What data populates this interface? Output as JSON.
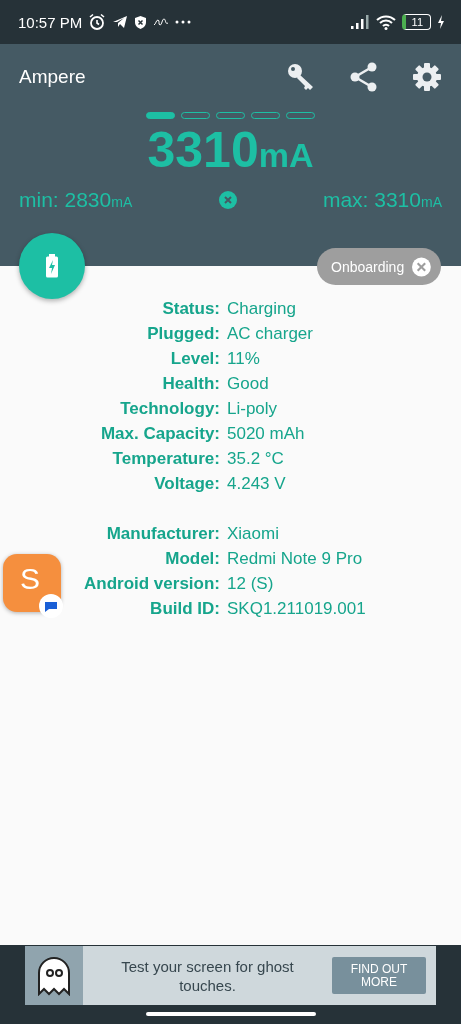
{
  "status_bar": {
    "time": "10:57 PM",
    "battery": "11"
  },
  "app_bar": {
    "title": "Ampere"
  },
  "pager": [
    {
      "selected": true
    },
    {
      "selected": false
    },
    {
      "selected": false
    },
    {
      "selected": false
    },
    {
      "selected": false
    }
  ],
  "current": {
    "value": "3310",
    "unit": "mA"
  },
  "min": {
    "label": "min: 2830",
    "unit": "mA"
  },
  "max": {
    "label": "max: 3310",
    "unit": "mA"
  },
  "onboarding": {
    "label": "Onboarding"
  },
  "info_groups": [
    [
      {
        "label": "Status:",
        "value": "Charging"
      },
      {
        "label": "Plugged:",
        "value": "AC charger"
      },
      {
        "label": "Level:",
        "value": "11%"
      },
      {
        "label": "Health:",
        "value": "Good"
      },
      {
        "label": "Technology:",
        "value": "Li-poly"
      },
      {
        "label": "Max. Capacity:",
        "value": "5020 mAh"
      },
      {
        "label": "Temperature:",
        "value": "35.2 °C"
      },
      {
        "label": "Voltage:",
        "value": "4.243 V"
      }
    ],
    [
      {
        "label": "Manufacturer:",
        "value": "Xiaomi"
      },
      {
        "label": "Model:",
        "value": "Redmi Note 9 Pro"
      },
      {
        "label": "Android version:",
        "value": "12 (S)"
      },
      {
        "label": "Build ID:",
        "value": "SKQ1.211019.001"
      }
    ]
  ],
  "chat_head": {
    "letter": "S"
  },
  "ad": {
    "text": "Test your screen for ghost touches.",
    "button": "FIND OUT MORE"
  }
}
